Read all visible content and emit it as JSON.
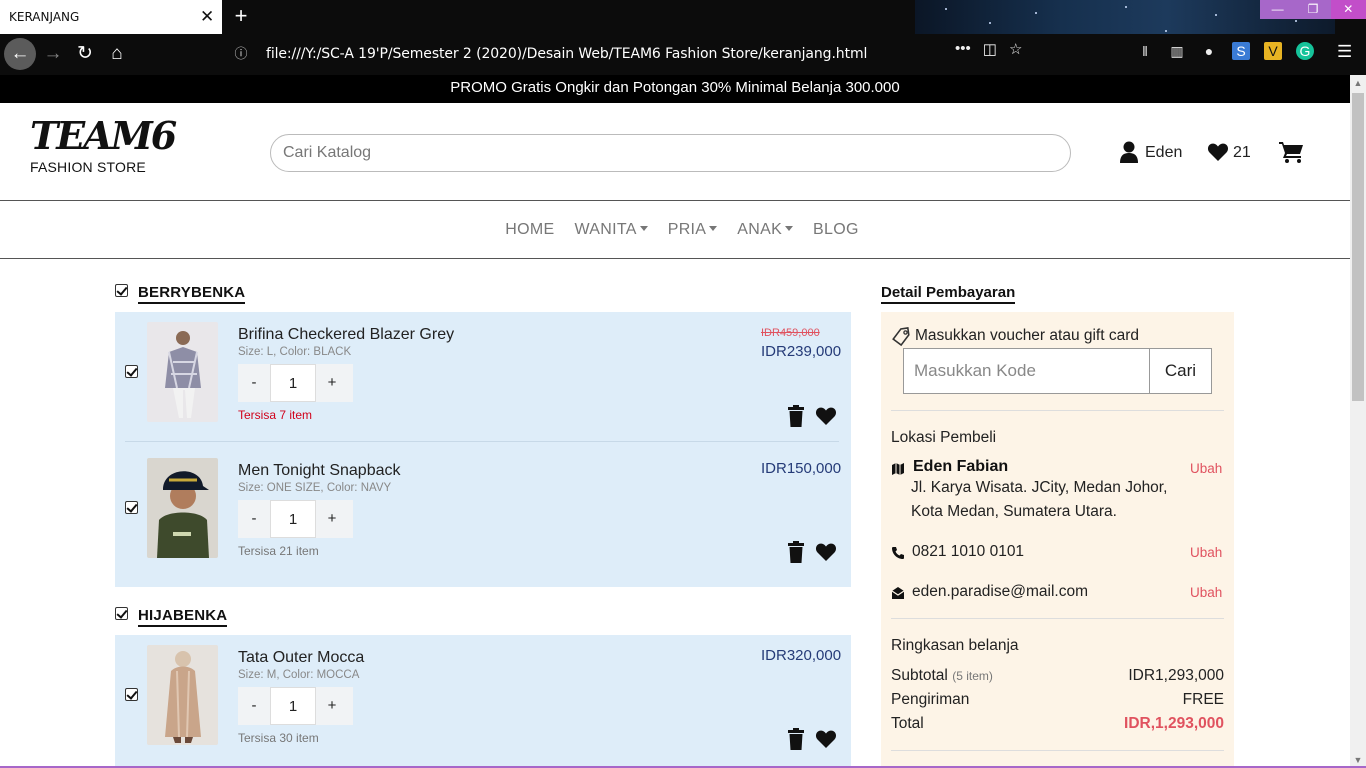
{
  "browser": {
    "tab_title": "KERANJANG",
    "url": "file:///Y:/SC-A 19'P/Semester 2 (2020)/Desain Web/TEAM6 Fashion Store/keranjang.html"
  },
  "promo": "PROMO Gratis Ongkir dan Potongan 30% Minimal Belanja 300.000",
  "header": {
    "logo_title": "TEAM6",
    "logo_subtitle": "FASHION STORE",
    "search_placeholder": "Cari Katalog",
    "user_name": "Eden",
    "wishlist_count": "21"
  },
  "nav": {
    "items": [
      {
        "label": "HOME",
        "dropdown": false
      },
      {
        "label": "WANITA",
        "dropdown": true
      },
      {
        "label": "PRIA",
        "dropdown": true
      },
      {
        "label": "ANAK",
        "dropdown": true
      },
      {
        "label": "BLOG",
        "dropdown": false
      }
    ]
  },
  "cart": {
    "stores": [
      {
        "name": "BERRYBENKA",
        "items": [
          {
            "name": "Brifina Checkered Blazer Grey",
            "meta": "Size: L, Color: BLACK",
            "qty": "1",
            "stock": "Tersisa 7 item",
            "old_price": "IDR459,000",
            "price": "IDR239,000"
          },
          {
            "name": "Men Tonight Snapback",
            "meta": "Size: ONE SIZE, Color: NAVY",
            "qty": "1",
            "stock": "Tersisa 21 item",
            "old_price": "",
            "price": "IDR150,000"
          }
        ]
      },
      {
        "name": "HIJABENKA",
        "items": [
          {
            "name": "Tata Outer Mocca",
            "meta": "Size: M, Color: MOCCA",
            "qty": "1",
            "stock": "Tersisa 30 item",
            "old_price": "",
            "price": "IDR320,000"
          }
        ]
      }
    ],
    "qty_minus": "-",
    "qty_plus": "+"
  },
  "payment": {
    "title": "Detail Pembayaran",
    "voucher_label": "Masukkan voucher atau gift card",
    "voucher_placeholder": "Masukkan Kode",
    "voucher_button": "Cari",
    "location_label": "Lokasi Pembeli",
    "buyer_name": "Eden Fabian",
    "address_line1": "Jl. Karya Wisata. JCity, Medan Johor,",
    "address_line2": "Kota Medan, Sumatera Utara.",
    "phone": "0821 1010 0101",
    "email": "eden.paradise@mail.com",
    "edit_label": "Ubah",
    "summary_label": "Ringkasan belanja",
    "subtotal_label": "Subtotal",
    "subtotal_count": "(5 item)",
    "subtotal_value": "IDR1,293,000",
    "shipping_label": "Pengiriman",
    "shipping_value": "FREE",
    "total_label": "Total",
    "total_value": "IDR,1,293,000"
  },
  "colors": {
    "store_box": "#deedf9",
    "payment_box": "#fdf4e7",
    "price": "#253b78",
    "accent_red": "#e0525f"
  }
}
